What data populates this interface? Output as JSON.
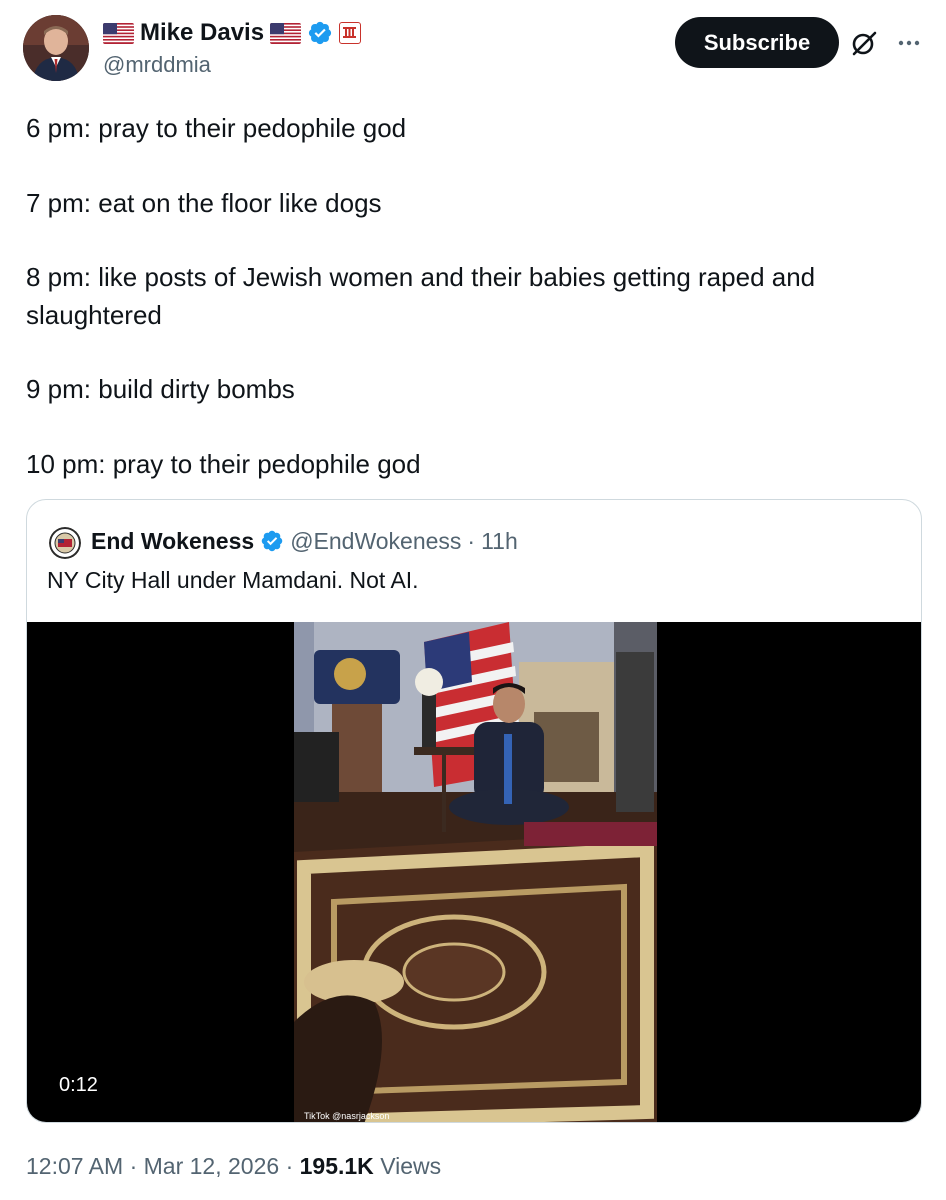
{
  "author": {
    "name": "Mike Davis",
    "handle": "@mrddmia"
  },
  "actions": {
    "subscribe_label": "Subscribe"
  },
  "tweet": {
    "lines": [
      "6 pm: pray to their pedophile god",
      "7 pm: eat on the floor like dogs",
      "8 pm: like posts of Jewish women and their babies getting raped and slaughtered",
      "9 pm: build dirty bombs",
      "10 pm: pray to their pedophile god"
    ]
  },
  "quote": {
    "name": "End Wokeness",
    "handle": "@EndWokeness",
    "separator": "·",
    "time": "11h",
    "text": "NY City Hall under Mamdani. Not AI.",
    "video": {
      "duration": "0:12",
      "watermark": "TikTok @nasrjackson"
    }
  },
  "footer": {
    "time": "12:07 AM",
    "sep1": "·",
    "date": "Mar 12, 2026",
    "sep2": "·",
    "views_count": "195.1K",
    "views_label": "Views"
  },
  "icons": {
    "verified": "verified-badge-icon",
    "flag": "us-flag-icon",
    "affiliate": "affiliate-badge-icon",
    "grok": "grok-icon",
    "more": "more-icon"
  },
  "colors": {
    "verified": "#1d9bf0",
    "subscribe_bg": "#0f1419",
    "secondary_text": "#536471",
    "border": "#cfd9de"
  }
}
